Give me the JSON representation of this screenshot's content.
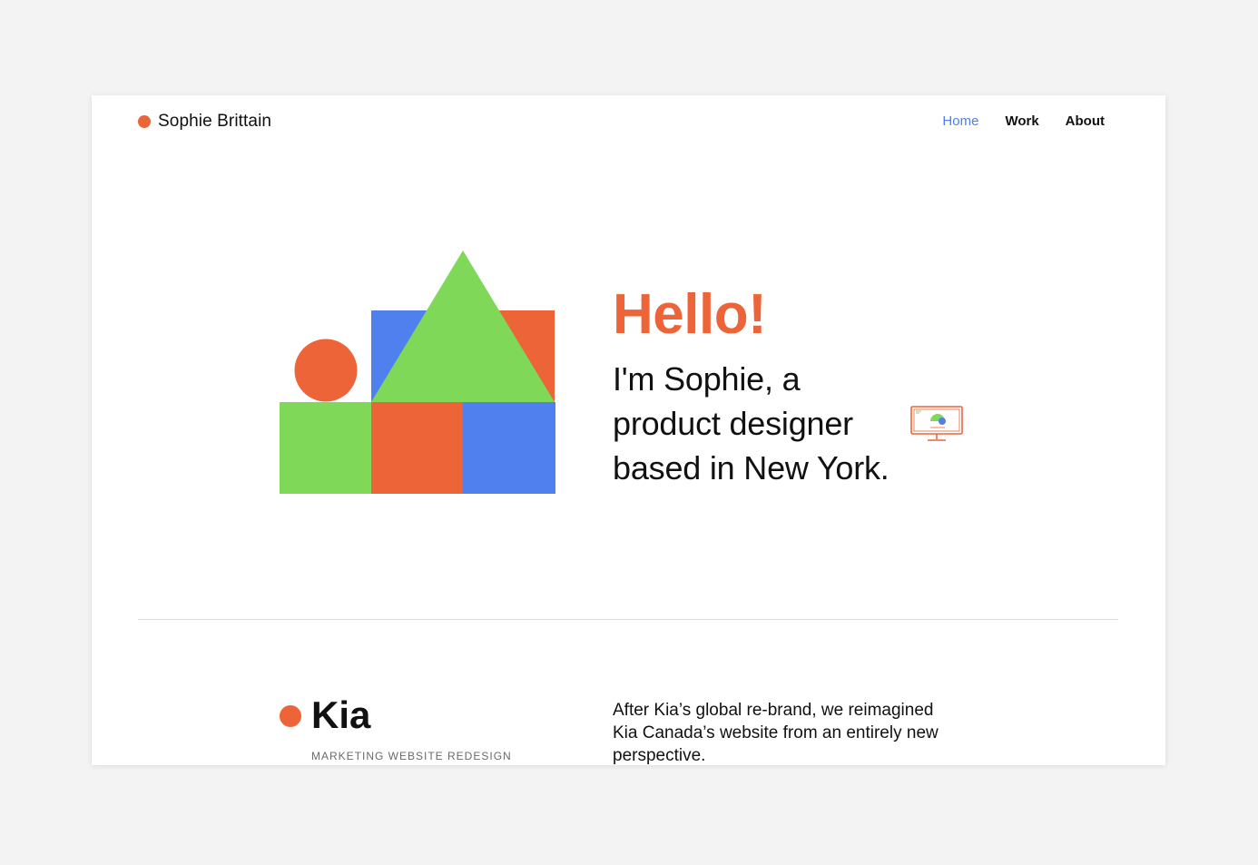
{
  "header": {
    "brand_name": "Sophie Brittain",
    "nav": [
      {
        "label": "Home",
        "active": true
      },
      {
        "label": "Work",
        "active": false
      },
      {
        "label": "About",
        "active": false
      }
    ]
  },
  "hero": {
    "greeting": "Hello!",
    "intro_lines": [
      "I'm Sophie, a",
      "product designer",
      "based in New York."
    ]
  },
  "project": {
    "title": "Kia",
    "subtitle": "MARKETING WEBSITE REDESIGN",
    "description": "After Kia’s global re-brand, we reimagined Kia Canada’s website from an entirely new perspective."
  },
  "colors": {
    "orange": "#ec6437",
    "green": "#7fd858",
    "blue": "#4f80ee",
    "nav_active": "#4f80ee"
  },
  "icons": {
    "brand": "orange-dot-icon",
    "intro": "monitor-chart-icon",
    "project": "orange-dot-icon"
  }
}
